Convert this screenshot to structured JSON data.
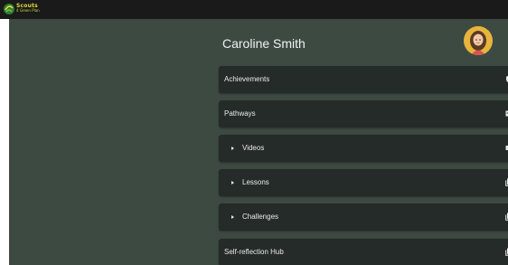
{
  "app": {
    "logo_line1": "Scouts",
    "logo_line2": "4 Green Plan"
  },
  "profile": {
    "name": "Caroline Smith"
  },
  "menu": {
    "items": [
      {
        "label": "Achievements",
        "icon": "shield-icon",
        "expandable": false
      },
      {
        "label": "Pathways",
        "icon": "book-icon",
        "expandable": false
      },
      {
        "label": "Videos",
        "icon": "video-icon",
        "expandable": true
      },
      {
        "label": "Lessons",
        "icon": "library-icon",
        "expandable": true
      },
      {
        "label": "Challenges",
        "icon": "library-icon",
        "expandable": true
      },
      {
        "label": "Self-reflection Hub",
        "icon": "library-icon",
        "expandable": false
      }
    ]
  },
  "colors": {
    "topbar": "#1a1a1a",
    "background": "#3d4a42",
    "item_background": "#252b28",
    "text": "#eaeaea",
    "avatar": "#e7b43c"
  }
}
